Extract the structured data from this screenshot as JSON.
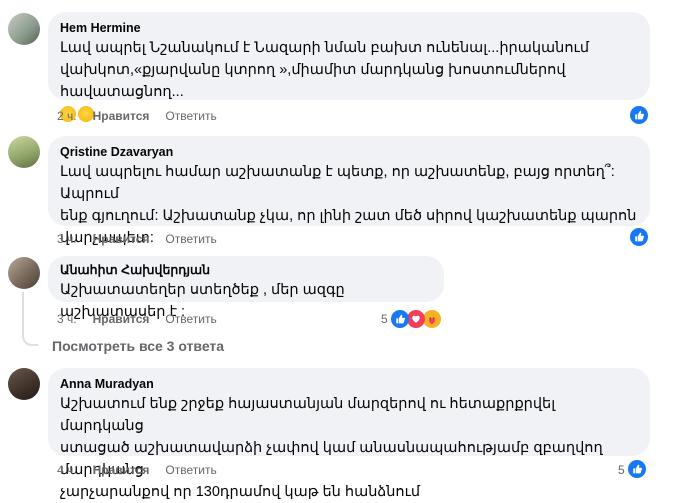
{
  "comments": [
    {
      "author": "Hem Hermine",
      "lines": [
        "Լավ ապրել Նշանակում է Նազարի նման բախտ ունենալ...իրականում",
        "վախկոտ,«քյարվանը կտրող »,միամիտ մարդկանց խոստումներով հավատացնող..."
      ],
      "time": "2 ч.",
      "like": "Нравится",
      "reply": "Ответить",
      "count": ""
    },
    {
      "author": "Qristine Dzavaryan",
      "lines": [
        "Լավ ապրելու համար աշխատանք է պետք, որ աշխատենք, բայց որտեղ՞: Ապրում",
        "ենք գյուղում: Աշխատանք չկա, որ լինի շատ մեծ սիրով կաշխատենք պարոն",
        "վարչապետ:"
      ],
      "time": "3 ч.",
      "like": "Нравится",
      "reply": "Ответить",
      "count": ""
    },
    {
      "author": "Անահիտ Հախվերդյան",
      "lines": [
        "Աշխատատեղեր ստեղծեք , մեր ազգը աշխատասեր է :"
      ],
      "time": "3 ч.",
      "like": "Нравится",
      "reply": "Ответить",
      "count": "5"
    },
    {
      "author": "Anna Muradyan",
      "lines": [
        "Աշխատում ենք շրջեք հայաստանյան մարզերով ու հետաքրքրվել մարդկանց",
        "ստացած աշխատավարձի չափով կամ անասնապահությամբ զբաղվող մարդկանց",
        "չարչարանքով որ 130դրամով կաթ են հանձնում"
      ],
      "time": "4 ч.",
      "like": "Нравится",
      "reply": "Ответить",
      "count": "5"
    }
  ],
  "see_replies": "Посмотреть все 3 ответа",
  "colors": {
    "like_blue": "#1877f2",
    "bubble": "#f0f2f5",
    "meta": "#65676b"
  },
  "icons": {
    "like": "thumbs-up-icon",
    "love": "heart-icon",
    "care": "care-icon",
    "emoji_wink": "kiss-emoji-icon",
    "emoji_roll": "eye-roll-emoji-icon"
  }
}
